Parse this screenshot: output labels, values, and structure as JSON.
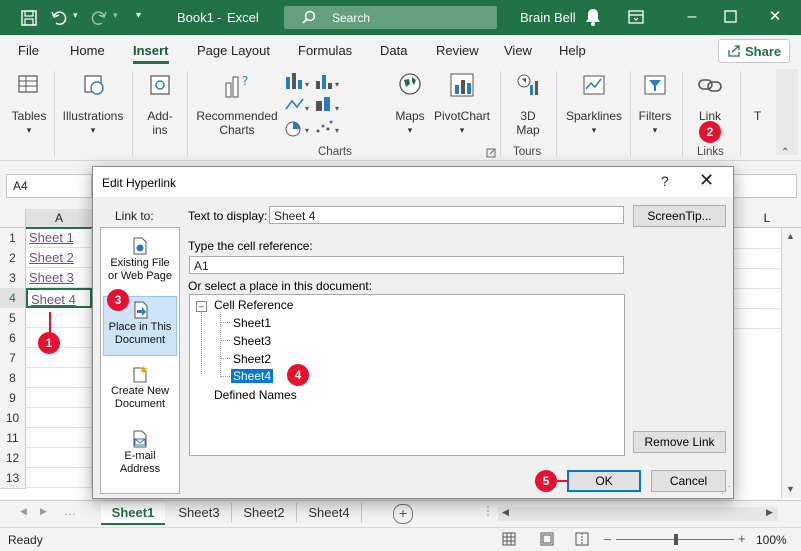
{
  "titlebar": {
    "workbook": "Book1",
    "separator": "-",
    "app": "Excel",
    "search_placeholder": "Search",
    "user": "Brain Bell"
  },
  "menu": {
    "tabs": [
      "File",
      "Home",
      "Insert",
      "Page Layout",
      "Formulas",
      "Data",
      "Review",
      "View",
      "Help"
    ],
    "active_tab": "Insert",
    "share_label": "Share"
  },
  "ribbon": {
    "tables": "Tables",
    "illustrations": "Illustrations",
    "addins_line1": "Add-",
    "addins_line2": "ins",
    "recommended_line1": "Recommended",
    "recommended_line2": "Charts",
    "maps": "Maps",
    "pivotchart": "PivotChart",
    "map3d_line1": "3D",
    "map3d_line2": "Map",
    "sparklines": "Sparklines",
    "filters": "Filters",
    "link": "Link",
    "text_cut": "T",
    "group_charts": "Charts",
    "group_tours": "Tours",
    "group_links": "Links"
  },
  "formula_bar": {
    "name_box": "A4"
  },
  "grid": {
    "column_a": "A",
    "column_l": "L",
    "rows": [
      "1",
      "2",
      "3",
      "4",
      "5",
      "6",
      "7",
      "8",
      "9",
      "10",
      "11",
      "12",
      "13"
    ],
    "cells": [
      "Sheet 1",
      "Sheet 2",
      "Sheet 3",
      "Sheet 4"
    ]
  },
  "sheet_tabs": {
    "tabs": [
      "Sheet1",
      "Sheet3",
      "Sheet2",
      "Sheet4"
    ],
    "active": "Sheet1",
    "add_label": "+"
  },
  "status_bar": {
    "status": "Ready",
    "zoom": "100%"
  },
  "dialog": {
    "title": "Edit Hyperlink",
    "help": "?",
    "close": "✕",
    "link_to_label": "Link to:",
    "link_options": [
      {
        "line1": "Existing File",
        "line2": "or Web Page"
      },
      {
        "line1": "Place in This",
        "line2": "Document"
      },
      {
        "line1": "Create New",
        "line2": "Document"
      },
      {
        "line1": "E-mail",
        "line2": "Address"
      }
    ],
    "text_to_display_label": "Text to display:",
    "text_to_display_value": "Sheet 4",
    "screentip_label": "ScreenTip...",
    "cell_ref_label": "Type the cell reference:",
    "cell_ref_value": "A1",
    "select_place_label": "Or select a place in this document:",
    "tree_root": "Cell Reference",
    "tree_sheets": [
      "Sheet1",
      "Sheet3",
      "Sheet2",
      "Sheet4"
    ],
    "tree_selected": "Sheet4",
    "defined_names": "Defined Names",
    "remove_link_label": "Remove Link",
    "ok_label": "OK",
    "cancel_label": "Cancel"
  },
  "callouts": [
    "1",
    "2",
    "3",
    "4",
    "5"
  ],
  "colors": {
    "excel_green": "#217346",
    "callout_red": "#e8102e",
    "selection_blue": "#0078d7"
  }
}
